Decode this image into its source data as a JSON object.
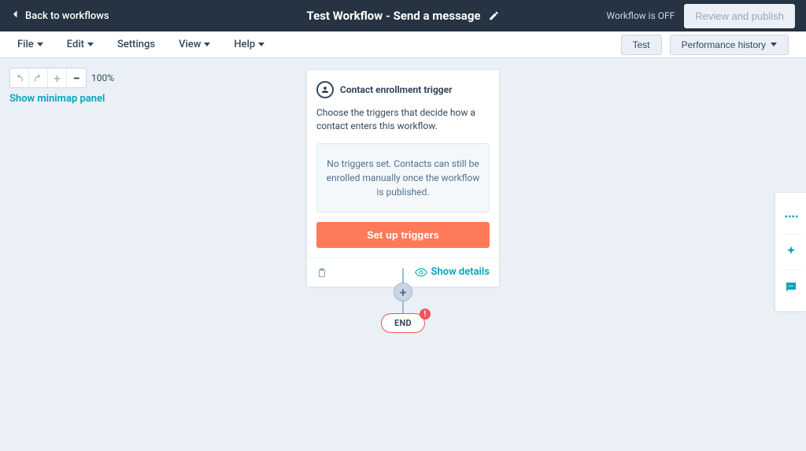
{
  "header": {
    "back_label": "Back to workflows",
    "title": "Test Workflow - Send a message",
    "status_label": "Workflow is OFF",
    "publish_label": "Review and publish"
  },
  "menu": {
    "items": [
      "File",
      "Edit",
      "Settings",
      "View",
      "Help"
    ],
    "test_label": "Test",
    "history_label": "Performance history"
  },
  "zoom": {
    "level": "100%",
    "minimap_label": "Show minimap panel"
  },
  "card": {
    "title": "Contact enrollment trigger",
    "description": "Choose the triggers that decide how a contact enters this workflow.",
    "empty": "No triggers set. Contacts can still be enrolled manually once the workflow is published.",
    "button": "Set up triggers",
    "details": "Show details"
  },
  "end": {
    "label": "END",
    "badge": "!"
  }
}
